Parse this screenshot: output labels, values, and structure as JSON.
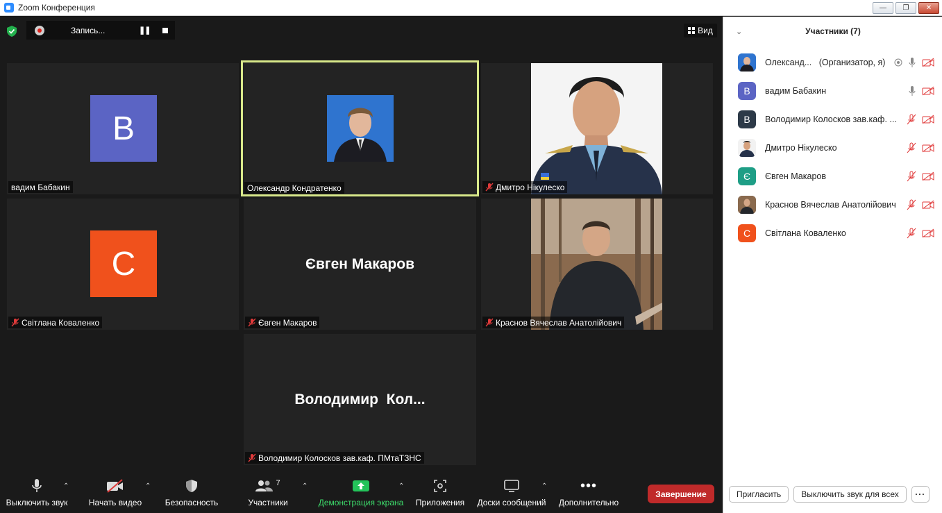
{
  "window": {
    "title": "Zoom Конференция"
  },
  "recording": {
    "label": "Запись..."
  },
  "view_button": {
    "label": "Вид"
  },
  "tiles": {
    "t1": {
      "name": "вадим Бабакин",
      "initial": "В",
      "color": "#5b64c4"
    },
    "t2": {
      "name": "Олександр Кондратенко"
    },
    "t3": {
      "name": "Дмитро Нікулеско"
    },
    "t4": {
      "name": "Світлана Коваленко",
      "initial": "С",
      "color": "#f0511c"
    },
    "t5": {
      "name": "Євген Макаров",
      "big_name": "Євген Макаров"
    },
    "t6": {
      "name": "Краснов Вячеслав Анатолійович"
    },
    "t7": {
      "name": "Володимир Колосков зав.каф. ПМтаТЗНС",
      "big_name": "Володимир  Кол..."
    }
  },
  "toolbar": {
    "mute": "Выключить звук",
    "video": "Начать видео",
    "security": "Безопасность",
    "participants": "Участники",
    "participants_count": "7",
    "share": "Демонстрация экрана",
    "apps": "Приложения",
    "whiteboards": "Доски сообщений",
    "more": "Дополнительно",
    "end": "Завершение"
  },
  "panel": {
    "title": "Участники (7)",
    "participants": [
      {
        "name": "Олександ...",
        "role": "(Организатор, я)",
        "initial": "",
        "color": "#3a6fbf"
      },
      {
        "name": "вадим Бабакин",
        "initial": "В",
        "color": "#5b64c4"
      },
      {
        "name": "Володимир Колосков зав.каф. ...",
        "initial": "В",
        "color": "#2d3a48"
      },
      {
        "name": "Дмитро Нікулеско",
        "initial": "",
        "color": "#3b4a5c"
      },
      {
        "name": "Євген Макаров",
        "initial": "Є",
        "color": "#1e9e86"
      },
      {
        "name": "Краснов Вячеслав Анатолійович",
        "initial": "",
        "color": "#6b6257"
      },
      {
        "name": "Світлана Коваленко",
        "initial": "С",
        "color": "#f0511c"
      }
    ],
    "invite": "Пригласить",
    "mute_all": "Выключить звук для всех",
    "more": "···"
  }
}
